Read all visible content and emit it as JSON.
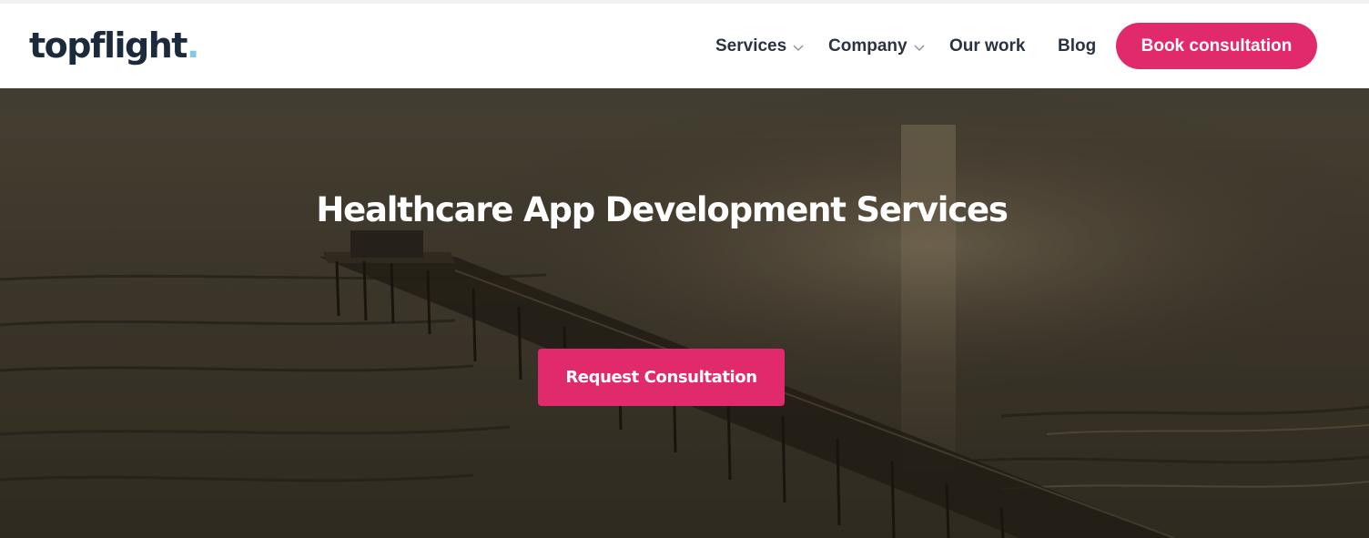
{
  "brand": {
    "logo_text": "topflight",
    "logo_dot": ".",
    "logo_color": "#1b2a3c",
    "dot_color": "#7fcbe6"
  },
  "nav": {
    "services": "Services",
    "company": "Company",
    "our_work": "Our work",
    "blog": "Blog",
    "book_button": "Book consultation",
    "dropdown_icon": "chevron-down-icon"
  },
  "hero": {
    "title": "Healthcare App Development Services",
    "cta_button": "Request Consultation",
    "background": "aerial-pier-ocean-sunset"
  },
  "colors": {
    "accent": "#e02a6c",
    "text_dark": "#2a3340"
  }
}
